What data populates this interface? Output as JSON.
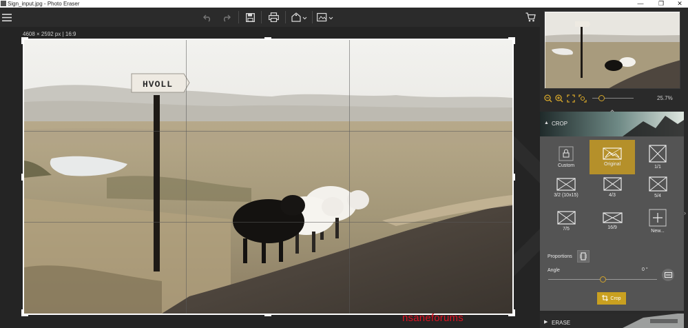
{
  "window": {
    "title": "Sign_input.jpg - Photo Eraser",
    "minimize": "—",
    "maximize": "❐",
    "close": "✕"
  },
  "toolbar": {
    "menu_icon": "hamburger-menu-icon",
    "undo_icon": "undo-icon",
    "redo_icon": "redo-icon",
    "save_icon": "save-icon",
    "print_icon": "printer-icon",
    "share_icon": "share-icon",
    "export_icon": "export-icon",
    "cart_icon": "shopping-cart-icon"
  },
  "canvas": {
    "image_dimensions": "4608 × 2592 px | 16:9",
    "sign_text": "HVOLL"
  },
  "zoom": {
    "value": "25.7%",
    "slider_level": 0.15,
    "zoom_out_icon": "zoom-out-icon",
    "zoom_in_icon": "zoom-in-icon",
    "fit_icon": "fit-screen-icon",
    "actual_size_icon": "actual-size-icon"
  },
  "crop_panel": {
    "title": "CROP",
    "presets": [
      {
        "label": "Custom",
        "icon": "lock-icon",
        "selected": false
      },
      {
        "label": "Original",
        "icon": "image-icon",
        "selected": true
      },
      {
        "label": "1/1",
        "icon": "ratio-icon",
        "selected": false
      },
      {
        "label": "3/2 (10x15)",
        "icon": "ratio-icon",
        "selected": false
      },
      {
        "label": "4/3",
        "icon": "ratio-icon",
        "selected": false
      },
      {
        "label": "5/4",
        "icon": "ratio-icon",
        "selected": false
      },
      {
        "label": "7/5",
        "icon": "ratio-icon",
        "selected": false
      },
      {
        "label": "16/9",
        "icon": "ratio-icon",
        "selected": false
      },
      {
        "label": "New...",
        "icon": "plus-icon",
        "selected": false
      }
    ],
    "proportions_label": "Proportions",
    "angle_label": "Angle",
    "angle_value": "0 °",
    "angle_level": 0.5,
    "crop_button": "Crop"
  },
  "erase_panel": {
    "title": "ERASE"
  },
  "watermark": "nsaneforums",
  "colors": {
    "accent": "#c9a020",
    "panel": "#545454",
    "background": "#232323"
  }
}
